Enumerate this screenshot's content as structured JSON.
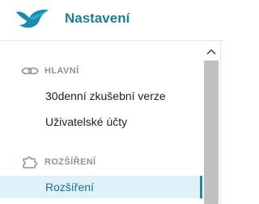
{
  "header": {
    "title": "Nastavení",
    "logo_icon": "bird-logo-icon",
    "brand_color": "#1b7c9a"
  },
  "nav": {
    "sections": [
      {
        "label": "HLAVNÍ",
        "icon": "link-icon",
        "items": [
          {
            "label": "30denní zkušební verze"
          },
          {
            "label": "Uživatelské účty"
          }
        ]
      },
      {
        "label": "ROZŠÍŘENÍ",
        "icon": "puzzle-icon",
        "items": [
          {
            "label": "Rozšíření",
            "active": true
          }
        ]
      }
    ]
  },
  "scrollbar": {
    "up_icon": "chevron-up-icon"
  }
}
